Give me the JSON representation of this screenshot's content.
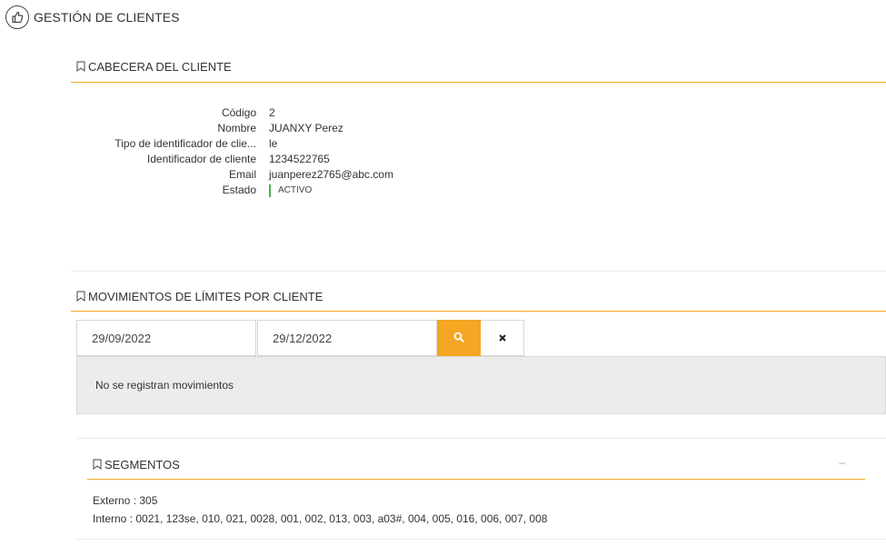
{
  "header": {
    "title": "GESTIÓN DE CLIENTES",
    "icon": "thumbs-up-icon"
  },
  "cabecera": {
    "title": "CABECERA DEL CLIENTE",
    "fields": [
      {
        "label": "Código",
        "value": "2"
      },
      {
        "label": "Nombre",
        "value": "JUANXY Perez"
      },
      {
        "label": "Tipo de identificador de clie...",
        "value": "le"
      },
      {
        "label": "Identificador de cliente",
        "value": "1234522765"
      },
      {
        "label": "Email",
        "value": "juanperez2765@abc.com"
      }
    ],
    "status": {
      "label": "Estado",
      "value": "ACTIVO",
      "color": "#4caf50"
    }
  },
  "movimientos": {
    "title": "MOVIMIENTOS DE LÍMITES POR CLIENTE",
    "date_from": "29/09/2022",
    "date_to": "29/12/2022",
    "search_icon": "search-icon",
    "clear_icon": "close-icon",
    "empty_message": "No se registran movimientos"
  },
  "segmentos": {
    "title": "SEGMENTOS",
    "collapse_symbol": "–",
    "externo": "Externo : 305",
    "interno": "Interno : 0021, 123se, 010, 021, 0028, 001, 002, 013, 003, a03#, 004, 005, 016, 006, 007, 008"
  },
  "colors": {
    "accent": "#f5a623",
    "panel": "#ececec",
    "status": "#4caf50"
  }
}
